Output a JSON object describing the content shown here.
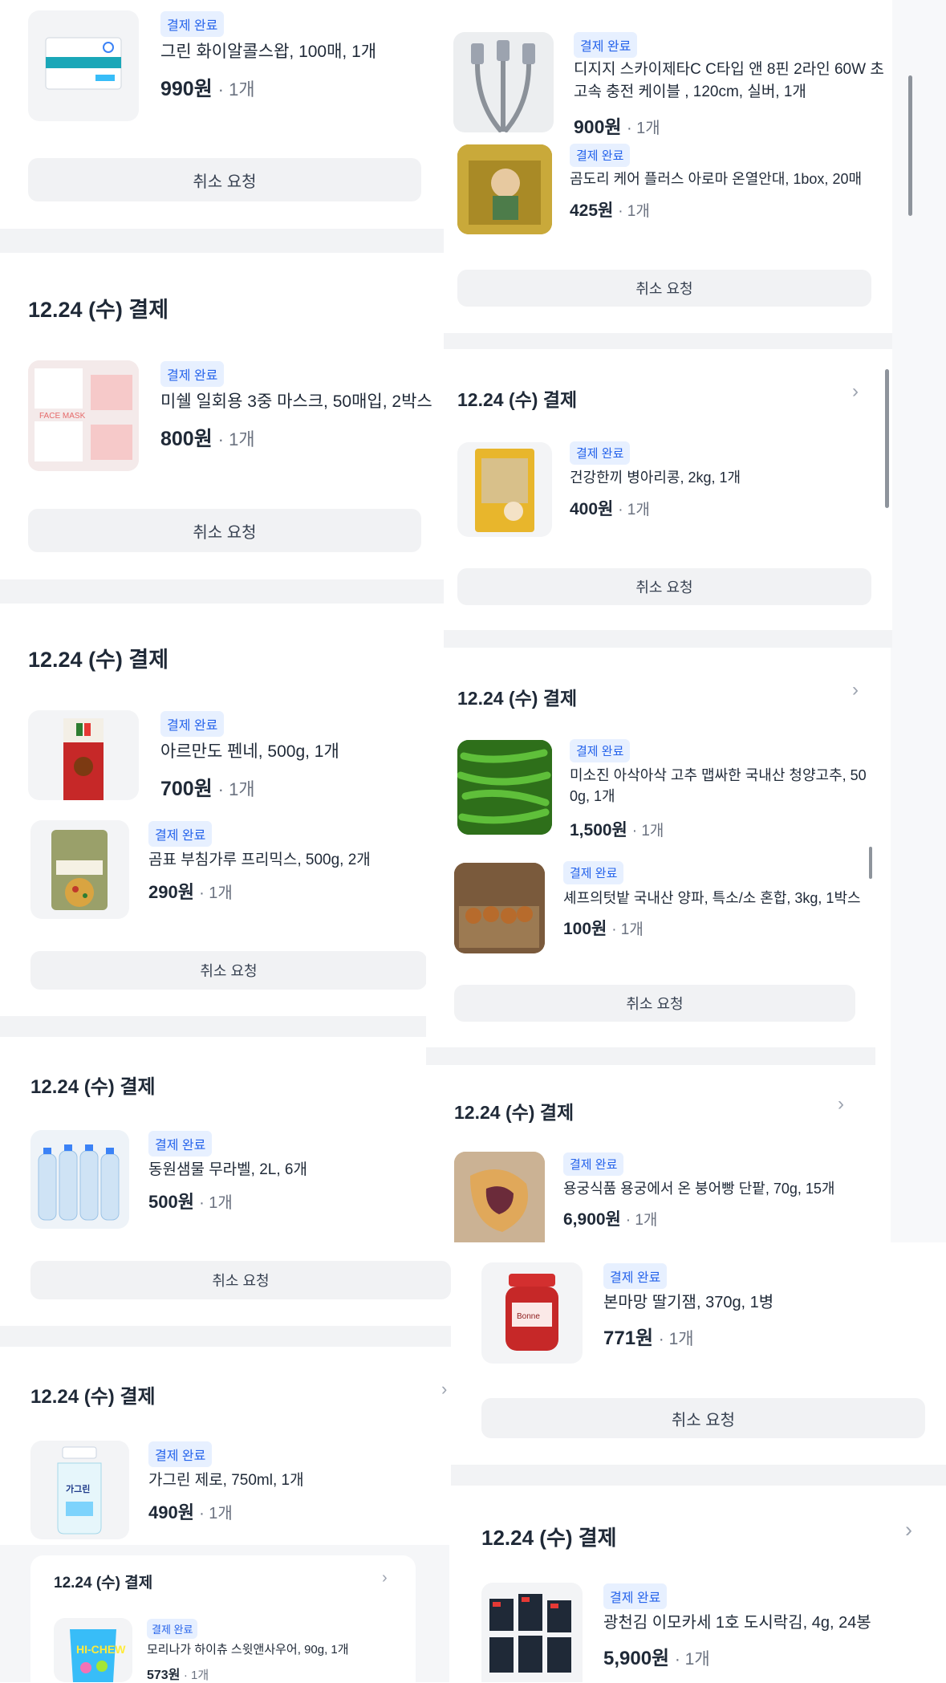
{
  "common": {
    "badge": "결제 완료",
    "cancel": "취소 요청",
    "group_title": "12.24 (수) 결제",
    "qty": "· 1개"
  },
  "products": {
    "hand_soap": {
      "name": "그린 화이알콜스왑, 100매, 1개",
      "price": "990원"
    },
    "mask": {
      "name": "미쉘 일회용 3중 마스크, 50매입, 2박스",
      "price": "800원"
    },
    "penne": {
      "name": "아르만도 펜네, 500g, 1개",
      "price": "700원"
    },
    "batter": {
      "name": "곰표 부침가루 프리믹스, 500g, 2개",
      "price": "290원"
    },
    "water": {
      "name": "동원샘물 무라벨, 2L, 6개",
      "price": "500원"
    },
    "mouthwash": {
      "name": "가그린 제로, 750ml, 1개",
      "price": "490원"
    },
    "candy": {
      "name": "모리나가 하이츄 스윗앤사우어, 90g, 1개",
      "price": "573원"
    },
    "cable": {
      "name": "디지지 스카이제타C C타입 앤 8핀 2라인 60W 초고속 충전 케이블 , 120cm, 실버, 1개",
      "price": "900원"
    },
    "warmer": {
      "name": "곰도리 케어 플러스 아로마 온열안대, 1box, 20매",
      "price": "425원"
    },
    "beans": {
      "name": "건강한끼 병아리콩, 2kg, 1개",
      "price": "400원"
    },
    "pepper": {
      "name": "미소진 아삭아삭 고추 맵싸한 국내산 청양고추, 500g, 1개",
      "price": "1,500원"
    },
    "onion": {
      "name": "셰프의텃밭 국내산 양파, 특소/소 혼합, 3kg, 1박스",
      "price": "100원"
    },
    "bungeo": {
      "name": "용궁식품 용궁에서 온 붕어빵 단팥, 70g, 15개",
      "price": "6,900원"
    },
    "jam": {
      "name": "본마망 딸기잼, 370g, 1병",
      "price": "771원"
    },
    "seaweed": {
      "name": "광천김 이모카세 1호 도시락김, 4g, 24봉",
      "price": "5,900원"
    }
  },
  "icons": {
    "chevron": "chevron-right-icon"
  },
  "colors": {
    "badge_bg": "#e7f0ff",
    "badge_text": "#2563eb",
    "divider": "#f2f3f5"
  }
}
